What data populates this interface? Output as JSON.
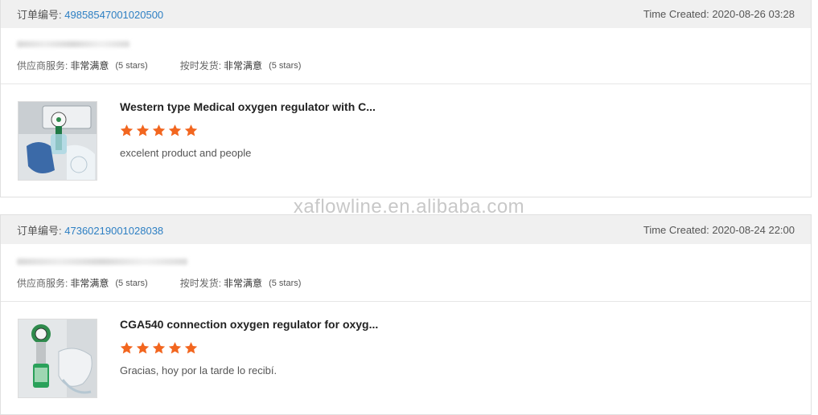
{
  "orders": [
    {
      "order_label": "订单编号:",
      "order_number": "49858547001020500",
      "time_created": "Time Created: 2020-08-26 03:28",
      "supplier_label": "供应商服务:",
      "supplier_value": "非常满意",
      "supplier_stars": "(5 stars)",
      "shipping_label": "按时发货:",
      "shipping_value": "非常满意",
      "shipping_stars": "(5 stars)",
      "product_title": "Western type Medical oxygen regulator with C...",
      "rating": 5,
      "comment": "excelent product and people"
    },
    {
      "order_label": "订单编号:",
      "order_number": "47360219001028038",
      "time_created": "Time Created: 2020-08-24 22:00",
      "supplier_label": "供应商服务:",
      "supplier_value": "非常满意",
      "supplier_stars": "(5 stars)",
      "shipping_label": "按时发货:",
      "shipping_value": "非常满意",
      "shipping_stars": "(5 stars)",
      "product_title": "CGA540 connection oxygen regulator for oxyg...",
      "rating": 5,
      "comment": "Gracias, hoy por la tarde lo recibí."
    }
  ],
  "watermark": "xaflowline.en.alibaba.com",
  "colors": {
    "star": "#f2661f",
    "order_number": "#2d7fc3",
    "header_bg": "#f0f0f0"
  }
}
